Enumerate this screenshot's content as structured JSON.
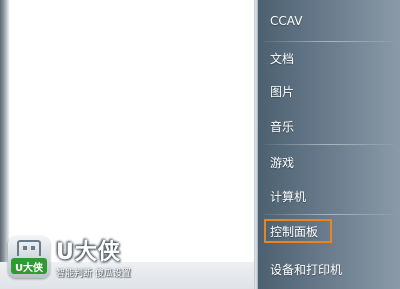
{
  "start_menu": {
    "right_items": [
      {
        "label": "CCAV"
      },
      {
        "label": "文档"
      },
      {
        "label": "图片"
      },
      {
        "label": "音乐"
      },
      {
        "label": "游戏"
      },
      {
        "label": "计算机"
      },
      {
        "label": "控制面板",
        "highlighted": true
      },
      {
        "label": "设备和打印机"
      }
    ]
  },
  "watermark": {
    "badge_text": "U大侠",
    "name": "U大侠",
    "tagline": "智能判断 傻瓜设置"
  },
  "colors": {
    "highlight_border": "#e98420",
    "badge_green": "#2f9a2f"
  }
}
